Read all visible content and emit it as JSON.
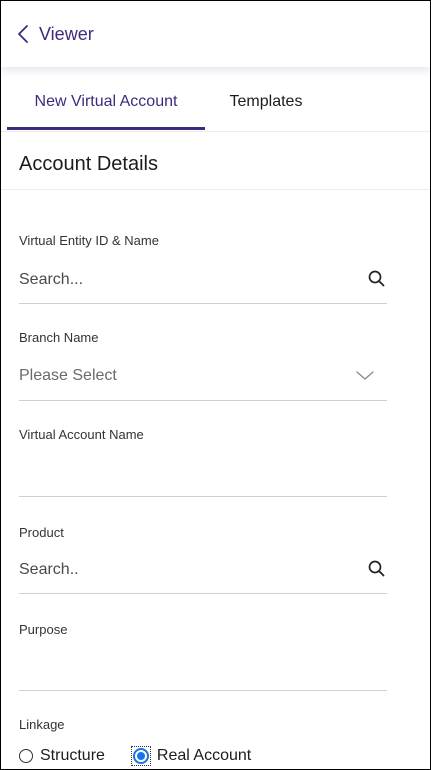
{
  "header": {
    "back_label": "Viewer"
  },
  "tabs": [
    {
      "label": "New Virtual Account",
      "active": true
    },
    {
      "label": "Templates",
      "active": false
    }
  ],
  "section": {
    "title": "Account Details"
  },
  "fields": {
    "virtual_entity": {
      "label": "Virtual Entity ID & Name",
      "placeholder": "Search..."
    },
    "branch": {
      "label": "Branch Name",
      "value": "Please Select"
    },
    "virtual_account_name": {
      "label": "Virtual Account Name",
      "value": ""
    },
    "product": {
      "label": "Product",
      "placeholder": "Search.."
    },
    "purpose": {
      "label": "Purpose",
      "value": ""
    }
  },
  "linkage": {
    "label": "Linkage",
    "options": [
      {
        "label": "Structure",
        "selected": false
      },
      {
        "label": "Real Account",
        "selected": true
      }
    ]
  },
  "colors": {
    "accent": "#3f2a7e",
    "radio_selected": "#1a73e8",
    "divider": "#cfcfcf"
  },
  "icons": {
    "back": "chevron-left-icon",
    "search": "search-icon",
    "dropdown": "chevron-down-icon"
  }
}
